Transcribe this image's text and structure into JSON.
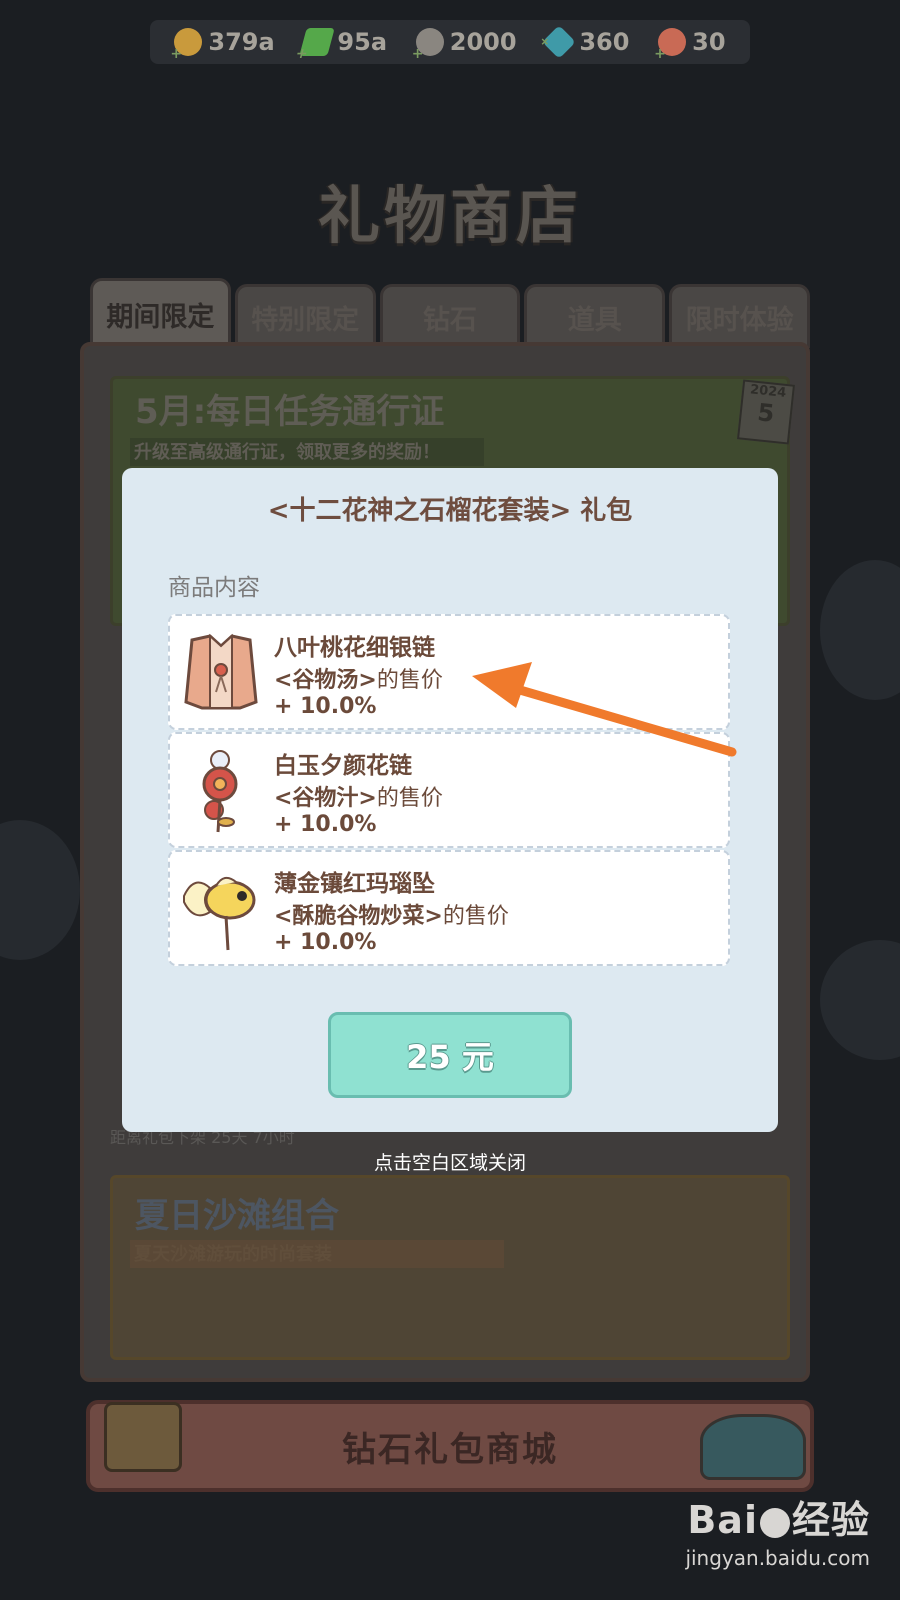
{
  "resources": [
    {
      "icon": "coin-icon",
      "value": "379a",
      "color": "#c99a3c"
    },
    {
      "icon": "energy-icon",
      "value": "95a",
      "color": "#55a84a"
    },
    {
      "icon": "grain-icon",
      "value": "2000",
      "color": "#8a8680"
    },
    {
      "icon": "diamond-icon",
      "value": "360",
      "color": "#3f9aa8"
    },
    {
      "icon": "ticket-icon",
      "value": "30",
      "color": "#c96a55"
    }
  ],
  "shop": {
    "title": "礼物商店",
    "tabs": [
      "期间限定",
      "特别限定",
      "钻石",
      "道具",
      "限时体验"
    ],
    "active_tab": 0
  },
  "background_cards": {
    "pass_title": "5月:每日任务通行证",
    "pass_subtitle": "升级至高级通行证，领取更多的奖励！",
    "calendar_year": "2024",
    "calendar_day": "5",
    "dimmed_caption": "距离礼包下架 25天 7小时",
    "beach_title": "夏日沙滩组合",
    "beach_subtitle": "夏天沙滩游玩的时尚套装"
  },
  "diamond_store_button": "钻石礼包商城",
  "modal": {
    "title": "<十二花神之石榴花套装> 礼包",
    "section_label": "商品内容",
    "items": [
      {
        "icon": "vest-icon",
        "name": "八叶桃花细银链",
        "target": "<谷物汤>",
        "suffix": "的售价",
        "bonus": "+ 10.0%"
      },
      {
        "icon": "flower-icon",
        "name": "白玉夕颜花链",
        "target": "<谷物汁>",
        "suffix": "的售价",
        "bonus": "+ 10.0%"
      },
      {
        "icon": "goldfish-icon",
        "name": "薄金镶红玛瑙坠",
        "target": "<酥脆谷物炒菜>",
        "suffix": "的售价",
        "bonus": "+ 10.0%"
      }
    ],
    "price_button": "25 元",
    "close_hint": "点击空白区域关闭"
  },
  "annotation": {
    "arrow_color": "#f07a2c"
  },
  "watermark": {
    "brand": "Bai",
    "suffix": "经验",
    "url": "jingyan.baidu.com"
  }
}
